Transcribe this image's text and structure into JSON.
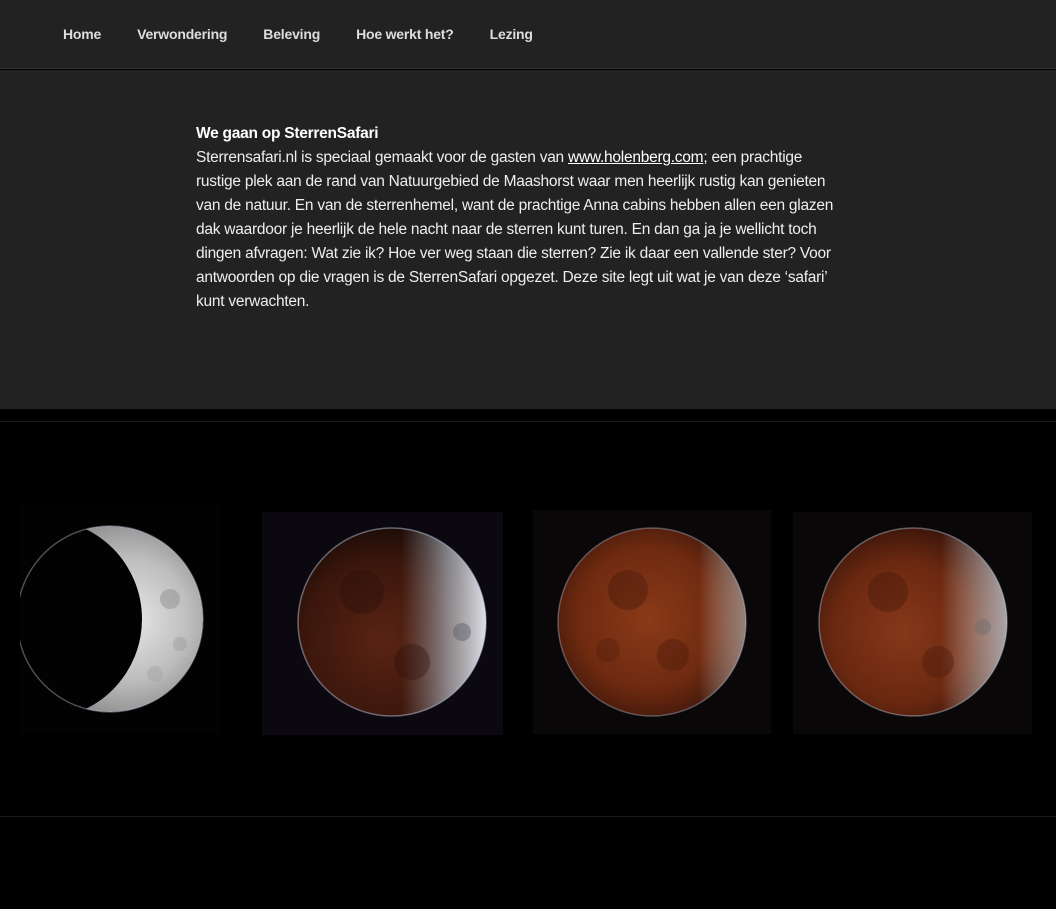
{
  "nav": {
    "items": [
      {
        "label": "Home"
      },
      {
        "label": "Verwondering"
      },
      {
        "label": "Beleving"
      },
      {
        "label": "Hoe werkt het?"
      },
      {
        "label": "Lezing"
      }
    ]
  },
  "entry": {
    "heading": "We gaan op SterrenSafari",
    "text_before_link": "Sterrensafari.nl is speciaal gemaakt voor de gasten van ",
    "link_text": "www.holenberg.com",
    "text_after_link": "; een prachtige rustige plek aan de rand van Natuurgebied de Maashorst waar men heerlijk rustig kan genieten van de natuur. En van de sterrenhemel, want de prachtige Anna cabins hebben allen een glazen dak waardoor je heerlijk de hele nacht naar de sterren kunt turen. En dan ga ja je wellicht toch dingen afvragen: Wat zie ik? Hoe ver weg staan die sterren? Zie ik daar een vallende ster? Voor antwoorden op die vragen is de SterrenSafari opgezet. Deze site legt uit wat je van deze ‘safari’ kunt verwachten."
  },
  "colors": {
    "header_bg": "#222222",
    "page_bg": "#000000",
    "text": "#eeeeee",
    "moon_white": "#d8d8d8",
    "moon_red": "#9a4220"
  }
}
